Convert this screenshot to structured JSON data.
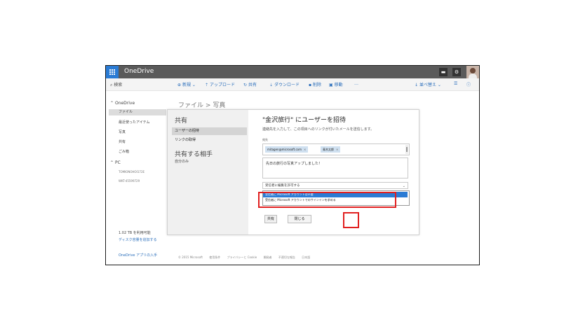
{
  "app": {
    "title": "OneDrive"
  },
  "search": {
    "label": "検索"
  },
  "commands": [
    {
      "icon": "plus-icon",
      "label": "新規 ⌄"
    },
    {
      "icon": "upload-icon",
      "label": "アップロード"
    },
    {
      "icon": "share-icon",
      "label": "共有"
    },
    {
      "icon": "download-icon",
      "label": "ダウンロード"
    },
    {
      "icon": "delete-icon",
      "label": "削除"
    },
    {
      "icon": "move-icon",
      "label": "移動"
    },
    {
      "icon": "more-icon",
      "label": "…"
    }
  ],
  "command_right": {
    "sort": "並べ替え ⌄",
    "view": "☰",
    "info": "ⓘ"
  },
  "nav": {
    "onedrive_header": "OneDrive",
    "items": [
      "ファイル",
      "最近使ったアイテム",
      "写真",
      "共有",
      "ごみ箱"
    ],
    "pc_header": "PC",
    "pcs": [
      "TOMIONOHOI172E",
      "WKT-45599729"
    ],
    "storage": "1.02 TB を利用可能",
    "storage_link": "ディスク容量を追加する",
    "app_link": "OneDrive アプリの入手"
  },
  "breadcrumb": {
    "root": "ファイル",
    "sep": ">",
    "current": "写真"
  },
  "dialog": {
    "left_title": "共有",
    "left_items": [
      "ユーザーの招待",
      "リンクの取得"
    ],
    "shared_with_title": "共有する相手",
    "shared_with_sub": "自分のみ",
    "title": "\"金沢旅行\" にユーザーを招待",
    "description": "連絡先を入力して、この項目へのリンクが付いたメールを送信します。",
    "to_label": "宛先",
    "recipients": [
      "mitagen@microsoft.com",
      "青木太郎"
    ],
    "message": "先日の旅行の写真アップしました！",
    "permission_selected": "受信者に編集を許可する",
    "permission_options": [
      "受信者に Microsoft アカウントは不要",
      "受信者に Microsoft アカウントでのサインインを求める"
    ],
    "share_button": "共有",
    "close_button": "閉じる"
  },
  "footer": [
    "© 2015 Microsoft",
    "使用条件",
    "プライバシーと Cookie",
    "開発者",
    "不適切な報告",
    "日本語"
  ],
  "colors": {
    "topbar": "#5a5a5a",
    "accent": "#2a7bd4",
    "highlight": "#e12020"
  }
}
